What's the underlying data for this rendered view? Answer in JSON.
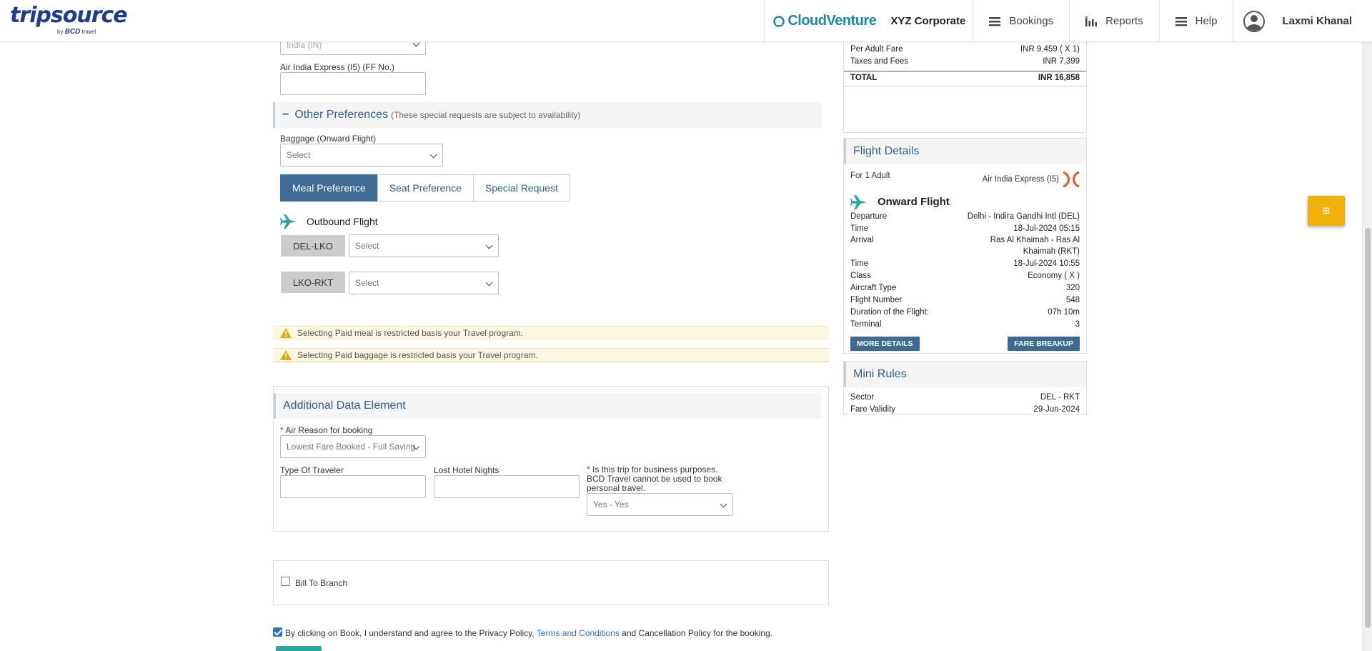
{
  "header": {
    "logo_main": "tripsource",
    "logo_by": "by",
    "logo_bcd": "BCD",
    "logo_travel": "travel",
    "brand_name": "CloudVenture",
    "corporate": "XYZ Corporate",
    "nav": [
      {
        "label": "Bookings",
        "icon": "hamburger-icon"
      },
      {
        "label": "Reports",
        "icon": "bar-chart-icon"
      },
      {
        "label": "Help",
        "icon": "hamburger-icon"
      }
    ],
    "user_name": "Laxmi Khanal"
  },
  "form": {
    "country_select": "India (IN)",
    "ff_label": "Air India Express (I5) (FF No.)",
    "ff_value": "",
    "other_prefs": {
      "toggle": "−",
      "title": "Other Preferences",
      "note": "(These special requests are subject to availability)"
    },
    "baggage_label": "Baggage (Onward Flight)",
    "baggage_select": "Select",
    "tabs": [
      "Meal Preference",
      "Seat Preference",
      "Special Request"
    ],
    "active_tab": "Meal Preference",
    "outbound_label": "Outbound Flight",
    "segments": [
      {
        "code": "DEL-LKO",
        "value": "Select"
      },
      {
        "code": "LKO-RKT",
        "value": "Select"
      }
    ],
    "warnings": [
      "Selecting Paid meal is restricted basis your Travel program.",
      "Selecting Paid baggage is restricted basis your Travel program."
    ],
    "ade": {
      "title": "Additional Data Element",
      "air_reason_label": "Air Reason for booking",
      "air_reason_value": "Lowest Fare Booked - Full Saving",
      "traveler_type_label": "Type Of Traveler",
      "lost_hotel_label": "Lost Hotel Nights",
      "business_label": "Is this trip for business purposes. BCD Travel cannot be used to book personal travel.",
      "business_value": "Yes - Yes"
    },
    "bill_to_branch": "Bill To Branch",
    "agree_text_1": "By clicking on Book, I understand and agree to the Privacy Policy,",
    "agree_link": "Terms and Conditions",
    "agree_text_2": "and Cancellation Policy for the booking."
  },
  "fare": {
    "rows": [
      {
        "k": "Per Adult Fare",
        "v": "INR 9,459 ( X 1)"
      },
      {
        "k": "Taxes and Fees",
        "v": "INR 7,399"
      }
    ],
    "total_label": "TOTAL",
    "total_value": "INR 16,858"
  },
  "flight": {
    "title": "Flight Details",
    "for_label": "For 1 Adult",
    "airline": "Air India Express (I5)",
    "onward_title": "Onward Flight",
    "rows": [
      {
        "k": "Departure",
        "v": "Delhi - Indira Gandhi Intl (DEL)"
      },
      {
        "k": "Time",
        "v": "18-Jul-2024 05:15"
      },
      {
        "k": "Arrival",
        "v": "Ras Al Khaimah - Ras Al"
      },
      {
        "k": "",
        "v": "Khaimah (RKT)"
      },
      {
        "k": "Time",
        "v": "18-Jul-2024 10:55"
      },
      {
        "k": "Class",
        "v": "Economy ( X )"
      },
      {
        "k": "Aircraft Type",
        "v": "320"
      },
      {
        "k": "Flight Number",
        "v": "548"
      },
      {
        "k": "Duration of the Flight:",
        "v": "07h 10m"
      },
      {
        "k": "Terminal",
        "v": "3"
      }
    ],
    "more_details": "MORE DETAILS",
    "fare_breakup": "FARE BREAKUP"
  },
  "mini_rules": {
    "title": "Mini Rules",
    "rows": [
      {
        "k": "Sector",
        "v": "DEL - RKT"
      },
      {
        "k": "Fare Validity",
        "v": "29-Jun-2024"
      }
    ]
  },
  "float_button_glyph": "⊞",
  "colors": {
    "accent": "#3e6b95",
    "brand": "#1a8aa6",
    "warning_bg": "#fcf8e3",
    "float_button": "#f0b10b"
  }
}
